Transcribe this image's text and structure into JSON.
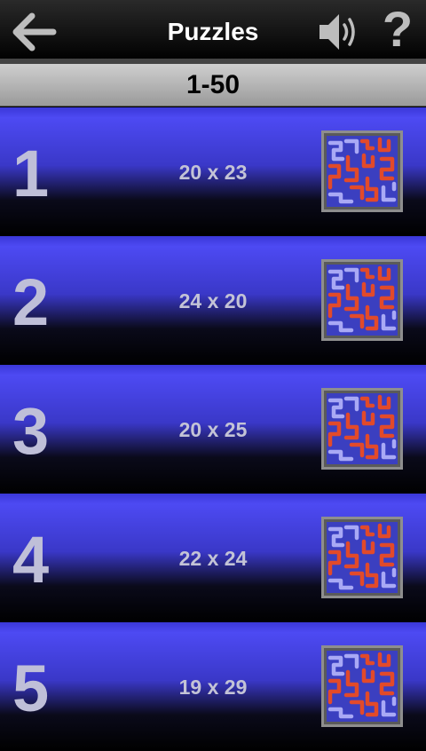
{
  "header": {
    "title": "Puzzles",
    "back_icon": "arrow-left-icon",
    "sound_icon": "speaker-icon",
    "help_label": "?"
  },
  "range": {
    "label": "1-50"
  },
  "puzzles": [
    {
      "number": "1",
      "size": "20 x 23"
    },
    {
      "number": "2",
      "size": "24 x 20"
    },
    {
      "number": "3",
      "size": "20 x 25"
    },
    {
      "number": "4",
      "size": "22 x 24"
    },
    {
      "number": "5",
      "size": "19 x 29"
    }
  ],
  "colors": {
    "row_blue": "#4d4af3",
    "pipe_red": "#e24a2a",
    "pipe_lavender": "#a9a9f5",
    "thumb_bg": "#3b3fc0"
  }
}
